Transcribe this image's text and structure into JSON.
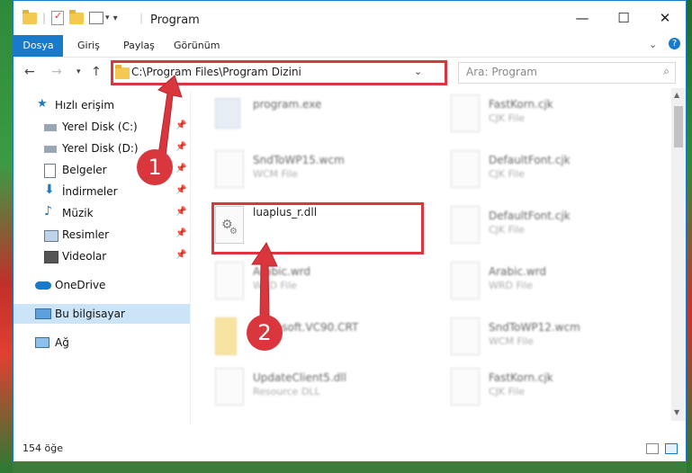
{
  "window": {
    "title": "Program",
    "minimize": "—",
    "maximize": "☐",
    "close": "✕",
    "accent": "#1979ca"
  },
  "ribbon": {
    "tabs": [
      "Dosya",
      "Giriş",
      "Paylaş",
      "Görünüm"
    ]
  },
  "nav": {
    "address": "C:\\Program Files\\Program Dizini",
    "search_placeholder": "Ara: Program"
  },
  "sidebar": {
    "items": [
      {
        "label": "Hızlı erişim",
        "icon": "star-icon"
      },
      {
        "label": "Yerel Disk (C:)",
        "icon": "drive-icon"
      },
      {
        "label": "Yerel Disk (D:)",
        "icon": "drive-icon"
      },
      {
        "label": "Belgeler",
        "icon": "documents-icon"
      },
      {
        "label": "İndirmeler",
        "icon": "download-icon"
      },
      {
        "label": "Müzik",
        "icon": "music-icon"
      },
      {
        "label": "Resimler",
        "icon": "pictures-icon"
      },
      {
        "label": "Videolar",
        "icon": "videos-icon"
      },
      {
        "label": "OneDrive",
        "icon": "cloud-icon"
      },
      {
        "label": "Bu bilgisayar",
        "icon": "computer-icon"
      },
      {
        "label": "Ağ",
        "icon": "network-icon"
      }
    ]
  },
  "files": [
    {
      "name": "program.exe",
      "type": ""
    },
    {
      "name": "FastKorn.cjk",
      "type": "CJK File"
    },
    {
      "name": "SndToWP15.wcm",
      "type": "WCM File"
    },
    {
      "name": "DefaultFont.cjk",
      "type": "CJK File"
    },
    {
      "name": "luaplus_r.dll",
      "type": ""
    },
    {
      "name": "DefaultFont.cjk",
      "type": "CJK File"
    },
    {
      "name": "Arabic.wrd",
      "type": "WRD File"
    },
    {
      "name": "Arabic.wrd",
      "type": "WRD File"
    },
    {
      "name": "Microsoft.VC90.CRT",
      "type": ""
    },
    {
      "name": "SndToWP12.wcm",
      "type": "WCM File"
    },
    {
      "name": "UpdateClient5.dll",
      "type": "Resource DLL"
    },
    {
      "name": "FastKorn.cjk",
      "type": "CJK File"
    }
  ],
  "status": {
    "count": "154 öğe"
  },
  "annotations": {
    "step1": "1",
    "step2": "2",
    "color": "#d9363e"
  }
}
